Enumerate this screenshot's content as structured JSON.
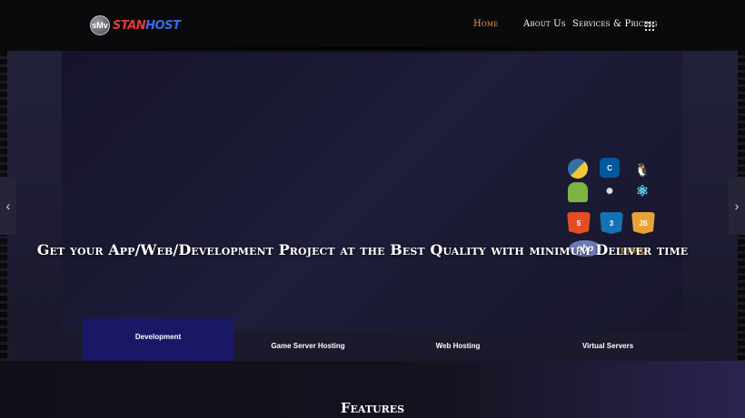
{
  "header": {
    "logo": {
      "badge": "sMv",
      "text_a": "STAN",
      "text_b": "HOST"
    },
    "nav": {
      "home": "Home",
      "about": "About Us",
      "services": "Services & Pricing"
    },
    "accent_color": "#f0a040",
    "menu_icon": "grid-menu-icon"
  },
  "hero": {
    "title": "Get your App/Web/Development Project at the Best Quality with minimum Deliver time",
    "prev_icon": "chevron-left-icon",
    "next_icon": "chevron-right-icon",
    "prev_glyph": "‹",
    "next_glyph": "›",
    "tech_icons": {
      "python": "python-icon",
      "cpp": "cpp-icon",
      "linux": "linux-icon",
      "android": "android-icon",
      "apple": "apple-icon",
      "react": "react-icon",
      "html5": "html5-icon",
      "css3": "css3-icon",
      "js": "js-icon",
      "php_label": "php",
      "mysql_label": "MySQL",
      "html5_label": "5",
      "css3_label": "3",
      "js_label": "JS",
      "cpp_label": "C",
      "linux_glyph": "🐧",
      "apple_glyph": "",
      "react_glyph": "⚛"
    }
  },
  "tabs": {
    "items": [
      {
        "label": "Development",
        "active": true
      },
      {
        "label": "Game Server Hosting",
        "active": false
      },
      {
        "label": "Web Hosting",
        "active": false
      },
      {
        "label": "Virtual Servers",
        "active": false
      }
    ],
    "active_color": "#1a1766"
  },
  "features": {
    "title": "Features"
  }
}
